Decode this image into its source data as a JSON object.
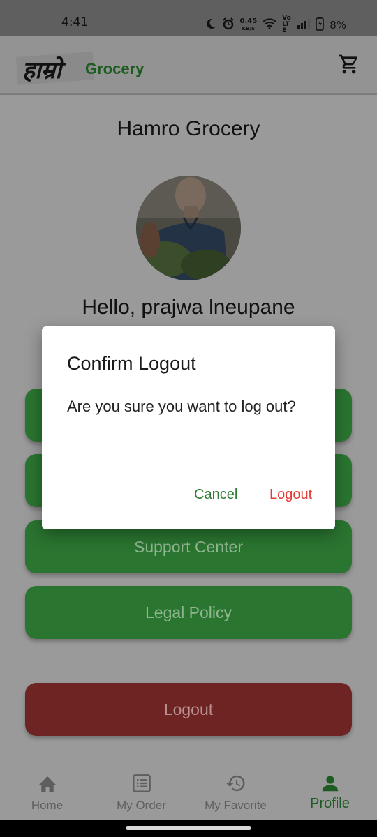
{
  "status_bar": {
    "time": "4:41",
    "network_speed_value": "0.45",
    "network_speed_unit": "KB/S",
    "volte": "Vo LTE",
    "battery": "8%",
    "icons": [
      "moon-icon",
      "alarm-icon",
      "wifi-icon",
      "signal-icon",
      "battery-icon"
    ]
  },
  "app_bar": {
    "logo_script": "हाम्रो",
    "logo_word": "Grocery",
    "cart_icon": "cart-icon"
  },
  "profile": {
    "store_name": "Hamro Grocery",
    "greeting": "Hello, prajwa lneupane"
  },
  "menu": {
    "item1": "",
    "item2": "",
    "support": "Support Center",
    "legal": "Legal Policy",
    "logout": "Logout"
  },
  "bottom_nav": {
    "home": "Home",
    "order": "My Order",
    "favorite": "My Favorite",
    "profile": "Profile",
    "active": "profile"
  },
  "dialog": {
    "title": "Confirm Logout",
    "message": "Are you sure you want to log out?",
    "cancel": "Cancel",
    "confirm": "Logout"
  },
  "colors": {
    "primary_green": "#2e7d32",
    "danger_red": "#e53935",
    "scrim": "#9a9a9a"
  }
}
